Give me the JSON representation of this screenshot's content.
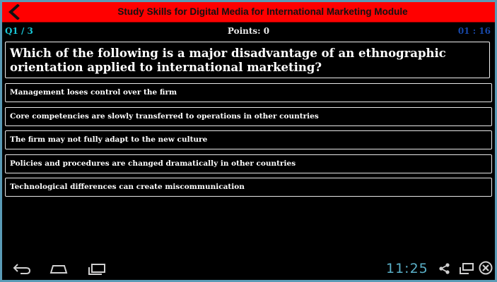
{
  "header": {
    "title": "Study Skills for Digital Media for International Marketing Module",
    "back_icon": "chevron-left-icon"
  },
  "status": {
    "question_counter": "Q1 / 3",
    "points": "Points: 0",
    "timer": "01 : 16"
  },
  "question": {
    "text": "Which of the following is a major disadvantage of an ethnographic orientation applied to international marketing?"
  },
  "answers": [
    "Management loses control over the firm",
    "Core competencies are slowly transferred to operations in other countries",
    "The firm may not fully adapt to the new culture",
    "Policies and procedures are changed dramatically in other countries",
    "Technological differences can create miscommunication"
  ],
  "navbar": {
    "clock": "11:25",
    "icons": [
      "back-icon",
      "home-icon",
      "recent-apps-icon",
      "share-icon",
      "window-icon",
      "close-icon"
    ]
  },
  "colors": {
    "titlebar": "#ff0000",
    "counter": "#18c6d6",
    "timer": "#1747a8",
    "clock": "#5ab0c8",
    "frame": "#5a9bb6"
  }
}
